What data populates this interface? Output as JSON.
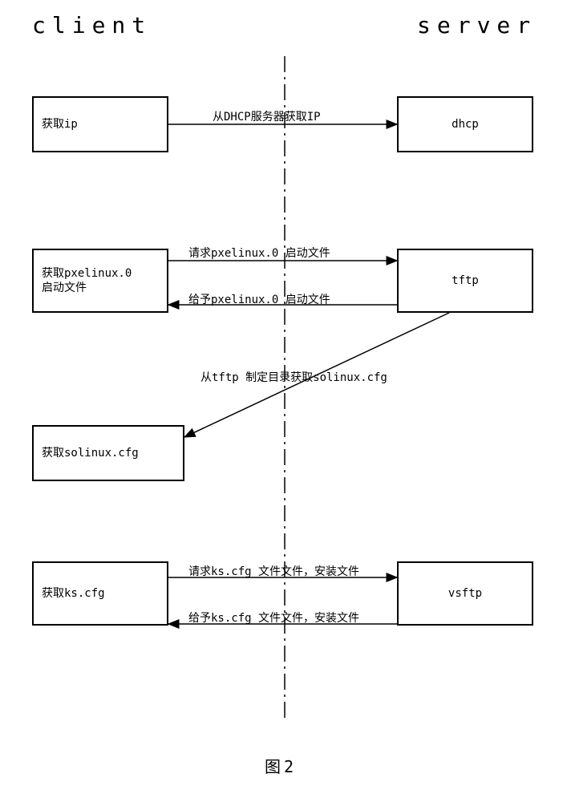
{
  "header": {
    "client": "client",
    "server": "server"
  },
  "boxes": {
    "get_ip": "获取ip",
    "dhcp": "dhcp",
    "get_pxe": "获取pxelinux.0\n启动文件",
    "tftp": "tftp",
    "get_solinux": "获取solinux.cfg",
    "get_ks": "获取ks.cfg",
    "vsftp": "vsftp"
  },
  "arrows": {
    "dhcp_ip": "从DHCP服务器获取IP",
    "req_pxe": "请求pxelinux.0 启动文件",
    "give_pxe": "给予pxelinux.0 启动文件",
    "tftp_solinux": "从tftp 制定目录获取solinux.cfg",
    "req_ks": "请求ks.cfg 文件文件，安装文件",
    "give_ks": "给予ks.cfg 文件文件，安装文件"
  },
  "caption": "图2"
}
